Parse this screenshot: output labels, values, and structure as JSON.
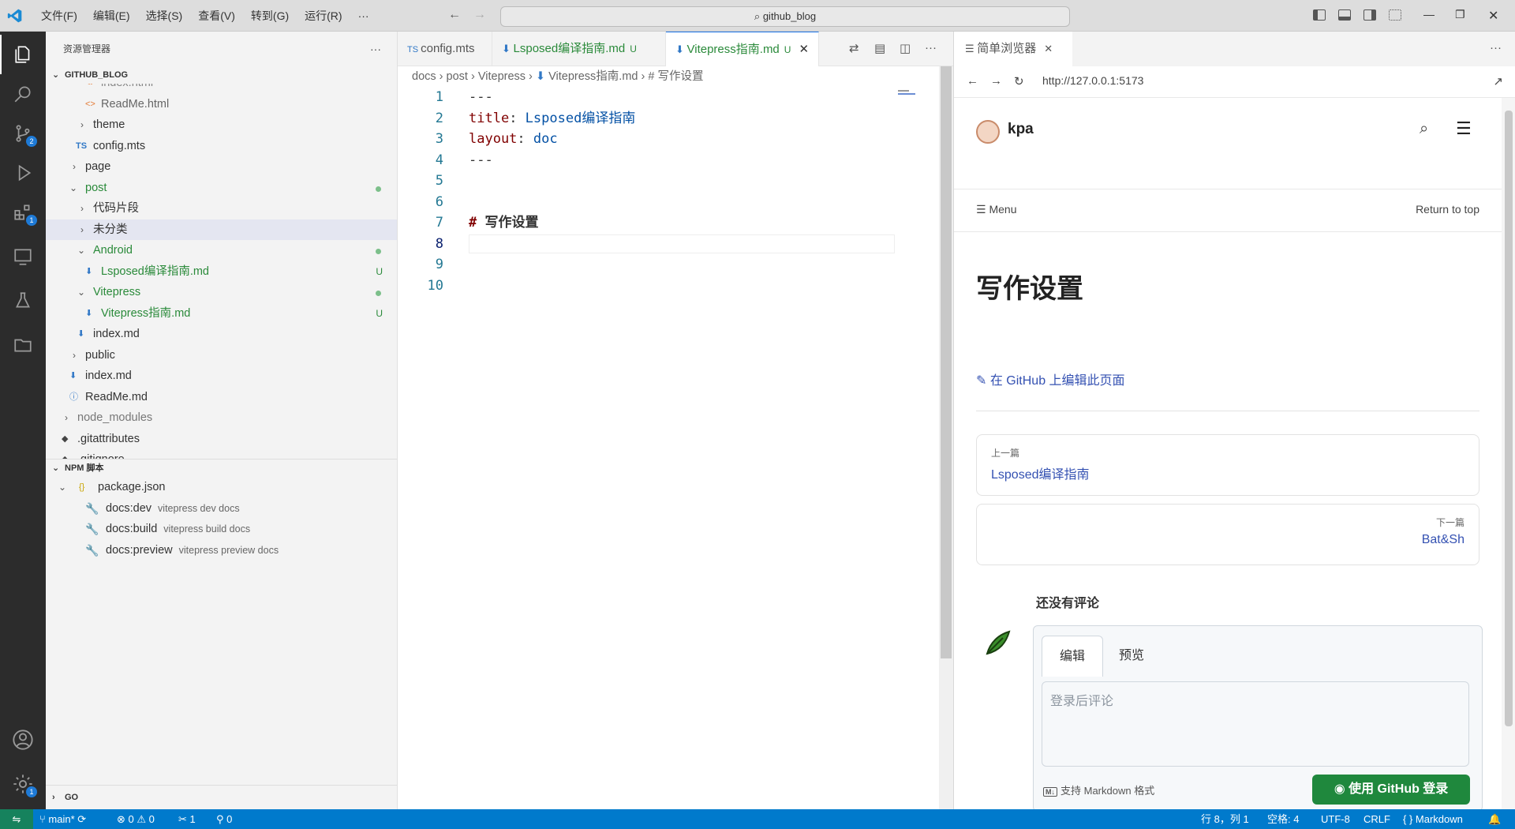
{
  "titlebar": {
    "menus": [
      "文件(F)",
      "编辑(E)",
      "选择(S)",
      "查看(V)",
      "转到(G)",
      "运行(R)",
      "···"
    ],
    "search": "github_blog"
  },
  "activity": {
    "scm_badge": "2",
    "ext_badge": "1",
    "settings_badge": "1"
  },
  "sidebar": {
    "title": "资源管理器",
    "root": "GITHUB_BLOG",
    "items": [
      {
        "label": "index.html",
        "icon": "<>"
      },
      {
        "label": "ReadMe.html",
        "icon": "<>"
      },
      {
        "label": "theme"
      },
      {
        "label": "config.mts",
        "icon": "TS"
      },
      {
        "label": "page"
      },
      {
        "label": "post"
      },
      {
        "label": "代码片段"
      },
      {
        "label": "未分类"
      },
      {
        "label": "Android"
      },
      {
        "label": "Lsposed编译指南.md",
        "status": "U"
      },
      {
        "label": "Vitepress"
      },
      {
        "label": "Vitepress指南.md",
        "status": "U"
      },
      {
        "label": "index.md"
      },
      {
        "label": "public"
      },
      {
        "label": "index.md"
      },
      {
        "label": "ReadMe.md"
      },
      {
        "label": "node_modules"
      },
      {
        "label": ".gitattributes"
      },
      {
        "label": ".gitignore"
      }
    ],
    "npm_title": "NPM 脚本",
    "npm_pkg": "package.json",
    "npm": [
      {
        "name": "docs:dev",
        "cmd": "vitepress dev docs"
      },
      {
        "name": "docs:build",
        "cmd": "vitepress build docs"
      },
      {
        "name": "docs:preview",
        "cmd": "vitepress preview docs"
      }
    ],
    "go": "GO"
  },
  "editor": {
    "tabs": [
      {
        "label": "config.mts"
      },
      {
        "label": "Lsposed编译指南.md",
        "status": "U"
      },
      {
        "label": "Vitepress指南.md",
        "status": "U"
      }
    ],
    "breadcrumb": [
      "docs",
      "post",
      "Vitepress",
      "Vitepress指南.md",
      "# 写作设置"
    ],
    "lines": [
      {
        "n": "1",
        "a": "---"
      },
      {
        "n": "2",
        "k": "title",
        "v": "Lsposed编译指南"
      },
      {
        "n": "3",
        "k": "layout",
        "v": "doc"
      },
      {
        "n": "4",
        "a": "---"
      },
      {
        "n": "5"
      },
      {
        "n": "6"
      },
      {
        "n": "7",
        "h": "写作设置"
      },
      {
        "n": "8"
      },
      {
        "n": "9"
      },
      {
        "n": "10"
      }
    ]
  },
  "browser": {
    "tab": "简单浏览器",
    "url": "http://127.0.0.1:5173",
    "site_title": "kpa",
    "menu": "Menu",
    "return_top": "Return to top",
    "h1": "写作设置",
    "edit": "在 GitHub 上编辑此页面",
    "prev_label": "上一篇",
    "prev": "Lsposed编译指南",
    "next_label": "下一篇",
    "next": "Bat&Sh",
    "comments": "还没有评论",
    "tab_edit": "编辑",
    "tab_preview": "预览",
    "placeholder": "登录后评论",
    "md_note": "支持 Markdown 格式",
    "login": "使用 GitHub 登录"
  },
  "status": {
    "branch": "main*",
    "errors": "0",
    "warnings": "0",
    "x": "1",
    "ports": "0",
    "pos": "行 8，列 1",
    "spaces": "空格: 4",
    "enc": "UTF-8",
    "eol": "CRLF",
    "lang": "Markdown"
  },
  "colors": {
    "accent": "#007acc",
    "link": "#3451b2",
    "git_added": "#2a8a3a",
    "github_btn": "#1f883d"
  }
}
